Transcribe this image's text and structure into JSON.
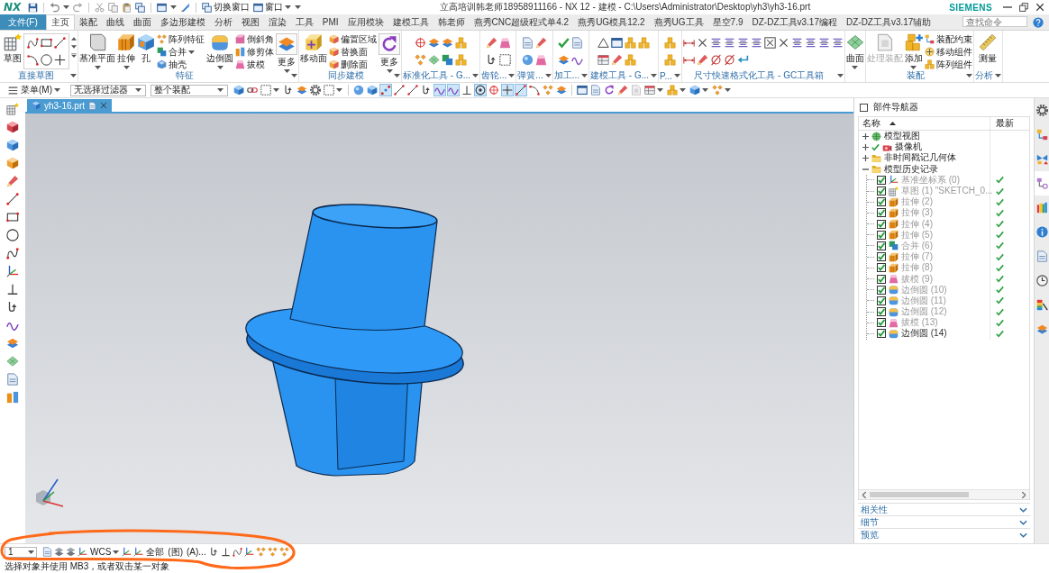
{
  "title_bar": {
    "logo": "NX",
    "quick_access": [
      {
        "label": "切换窗口",
        "dropdown": false
      },
      {
        "label": "窗口",
        "dropdown": true
      }
    ],
    "title": "立高培训韩老师18958911166 - NX 12 - 建模 - C:\\Users\\Administrator\\Desktop\\yh3\\yh3-16.prt",
    "brand": "SIEMENS"
  },
  "menu_tabs": [
    {
      "label": "文件(F)",
      "kind": "file",
      "selected": false
    },
    {
      "label": "主页",
      "kind": "tab",
      "selected": true
    },
    {
      "label": "装配",
      "kind": "tab",
      "selected": false
    },
    {
      "label": "曲线",
      "kind": "tab",
      "selected": false
    },
    {
      "label": "曲面",
      "kind": "tab",
      "selected": false
    },
    {
      "label": "多边形建模",
      "kind": "tab",
      "selected": false
    },
    {
      "label": "分析",
      "kind": "tab",
      "selected": false
    },
    {
      "label": "视图",
      "kind": "tab",
      "selected": false
    },
    {
      "label": "渲染",
      "kind": "tab",
      "selected": false
    },
    {
      "label": "工具",
      "kind": "tab",
      "selected": false
    },
    {
      "label": "PMI",
      "kind": "tab",
      "selected": false
    },
    {
      "label": "应用模块",
      "kind": "tab",
      "selected": false
    },
    {
      "label": "建模工具",
      "kind": "tab",
      "selected": false
    },
    {
      "label": "韩老师",
      "kind": "tab",
      "selected": false
    },
    {
      "label": "燕秀CNC超级程式单4.2",
      "kind": "tab",
      "selected": false
    },
    {
      "label": "燕秀UG模具12.2",
      "kind": "tab",
      "selected": false
    },
    {
      "label": "燕秀UG工具",
      "kind": "tab",
      "selected": false
    },
    {
      "label": "星空7.9",
      "kind": "tab",
      "selected": false
    },
    {
      "label": "DZ-DZ工具v3.17编程",
      "kind": "tab",
      "selected": false
    },
    {
      "label": "DZ-DZ工具v3.17辅助",
      "kind": "tab",
      "selected": false
    }
  ],
  "search": {
    "placeholder": "查找命令"
  },
  "ribbon": [
    {
      "label": "直接草图",
      "tools": [
        {
          "kind": "large",
          "label": "草图",
          "dropdown": false,
          "disabled": false
        }
      ]
    },
    {
      "label": "特征",
      "tools": [
        {
          "kind": "large",
          "label": "基准平面",
          "dropdown": true,
          "disabled": false
        },
        {
          "kind": "large",
          "label": "拉伸",
          "dropdown": true,
          "disabled": false
        },
        {
          "kind": "large",
          "label": "孔",
          "dropdown": false,
          "disabled": false
        },
        {
          "kind": "small",
          "label": "阵列特征",
          "dropdown": false,
          "disabled": false
        },
        {
          "kind": "small",
          "label": "合并",
          "dropdown": true,
          "disabled": false
        },
        {
          "kind": "small",
          "label": "抽壳",
          "dropdown": false,
          "disabled": false
        },
        {
          "kind": "large",
          "label": "边倒圆",
          "dropdown": true,
          "disabled": false
        },
        {
          "kind": "small",
          "label": "倒斜角",
          "dropdown": false,
          "disabled": false
        },
        {
          "kind": "small",
          "label": "修剪体",
          "dropdown": false,
          "disabled": false
        },
        {
          "kind": "small",
          "label": "拔模",
          "dropdown": false,
          "disabled": false
        },
        {
          "kind": "split",
          "label": "更多",
          "dropdown": true,
          "disabled": false
        }
      ]
    },
    {
      "label": "同步建模",
      "tools": [
        {
          "kind": "large",
          "label": "移动面",
          "dropdown": false,
          "disabled": false
        },
        {
          "kind": "small",
          "label": "偏置区域",
          "dropdown": false,
          "disabled": false
        },
        {
          "kind": "small",
          "label": "替换面",
          "dropdown": false,
          "disabled": false
        },
        {
          "kind": "small",
          "label": "删除面",
          "dropdown": false,
          "disabled": false
        },
        {
          "kind": "split",
          "label": "更多",
          "dropdown": true,
          "disabled": false
        }
      ]
    },
    {
      "label": "标准化工具 - G..."
    },
    {
      "label": "齿轮..."
    },
    {
      "label": "弹簧..."
    },
    {
      "label": "加工..."
    },
    {
      "label": "建模工具 - G..."
    },
    {
      "label": "P..."
    },
    {
      "label": "尺寸快速格式化工具 - GC工具箱"
    },
    {
      "tools": [
        {
          "kind": "large",
          "label": "曲面",
          "dropdown": true,
          "disabled": false
        }
      ]
    },
    {
      "label": "装配",
      "tools": [
        {
          "kind": "large",
          "label": "处理装配",
          "dropdown": false,
          "disabled": true
        },
        {
          "kind": "large",
          "label": "添加",
          "dropdown": true,
          "disabled": false
        },
        {
          "kind": "small",
          "label": "装配约束",
          "dropdown": false,
          "disabled": false
        },
        {
          "kind": "small",
          "label": "移动组件",
          "dropdown": false,
          "disabled": false
        },
        {
          "kind": "small",
          "label": "阵列组件",
          "dropdown": false,
          "disabled": false
        }
      ]
    },
    {
      "label": "分析",
      "tools": [
        {
          "kind": "large",
          "label": "测量",
          "dropdown": false,
          "disabled": false
        }
      ]
    }
  ],
  "selection_bar": {
    "menu": "菜单(M)",
    "filter": "无选择过滤器",
    "scope": "整个装配",
    "snap_toggles": [
      {
        "on": false
      },
      {
        "on": false
      },
      {
        "on": true
      },
      {
        "on": false
      },
      {
        "on": false
      },
      {
        "on": false
      },
      {
        "on": true
      },
      {
        "on": true
      },
      {
        "on": false
      },
      {
        "on": true
      },
      {
        "on": false
      },
      {
        "on": true
      },
      {
        "on": true
      },
      {
        "on": false
      },
      {
        "on": false
      },
      {
        "on": false
      }
    ]
  },
  "document_tab": {
    "label": "yh3-16.prt",
    "selected": true
  },
  "part_navigator": {
    "title": "部件导航器",
    "columns": [
      {
        "label": "名称",
        "sorted": true
      },
      {
        "label": "最新",
        "sorted": false
      }
    ],
    "tree": [
      {
        "label": "模型视图",
        "kind": "view",
        "expanded": false,
        "checked": false
      },
      {
        "label": "摄像机",
        "kind": "camera",
        "expanded": false,
        "checked": true
      },
      {
        "label": "非时间戳记几何体",
        "kind": "folder",
        "expanded": false,
        "checked": false
      },
      {
        "label": "模型历史记录",
        "kind": "folder",
        "expanded": true,
        "checked": false,
        "children": [
          {
            "label": "基准坐标系 (0)",
            "kind": "datum",
            "checked": true,
            "current": false,
            "latest": true
          },
          {
            "label": "草图 (1) \"SKETCH_0...",
            "kind": "sketch",
            "checked": true,
            "current": false,
            "latest": true
          },
          {
            "label": "拉伸 (2)",
            "kind": "extrude",
            "checked": true,
            "current": false,
            "latest": true
          },
          {
            "label": "拉伸 (3)",
            "kind": "extrude",
            "checked": true,
            "current": false,
            "latest": true
          },
          {
            "label": "拉伸 (4)",
            "kind": "extrude",
            "checked": true,
            "current": false,
            "latest": true
          },
          {
            "label": "拉伸 (5)",
            "kind": "extrude",
            "checked": true,
            "current": false,
            "latest": true
          },
          {
            "label": "合并 (6)",
            "kind": "unite",
            "checked": true,
            "current": false,
            "latest": true
          },
          {
            "label": "拉伸 (7)",
            "kind": "extrude",
            "checked": true,
            "current": false,
            "latest": true
          },
          {
            "label": "拉伸 (8)",
            "kind": "extrude",
            "checked": true,
            "current": false,
            "latest": true
          },
          {
            "label": "拔模 (9)",
            "kind": "draft",
            "checked": true,
            "current": false,
            "latest": true
          },
          {
            "label": "边倒圆 (10)",
            "kind": "blend",
            "checked": true,
            "current": false,
            "latest": true
          },
          {
            "label": "边倒圆 (11)",
            "kind": "blend",
            "checked": true,
            "current": false,
            "latest": true
          },
          {
            "label": "边倒圆 (12)",
            "kind": "blend",
            "checked": true,
            "current": false,
            "latest": true
          },
          {
            "label": "拔模 (13)",
            "kind": "draft",
            "checked": true,
            "current": false,
            "latest": true
          },
          {
            "label": "边倒圆 (14)",
            "kind": "blend",
            "checked": true,
            "current": true,
            "latest": true
          }
        ]
      }
    ],
    "panels": [
      {
        "label": "相关性",
        "expanded": false
      },
      {
        "label": "细节",
        "expanded": false
      },
      {
        "label": "预览",
        "expanded": false
      }
    ]
  },
  "resource_bar": [
    {
      "selected": false
    },
    {
      "selected": false
    },
    {
      "selected": false
    },
    {
      "selected": true
    },
    {
      "selected": false
    },
    {
      "selected": false
    },
    {
      "selected": false
    },
    {
      "selected": false
    },
    {
      "selected": false
    },
    {
      "selected": false
    }
  ],
  "bottom_toolbar": {
    "layer": "1",
    "wcs": "WCS",
    "labels": [
      "全部",
      "(图)",
      "(A)..."
    ]
  },
  "status_bar": {
    "message": "选择对象并使用 MB3，或者双击某一对象"
  }
}
